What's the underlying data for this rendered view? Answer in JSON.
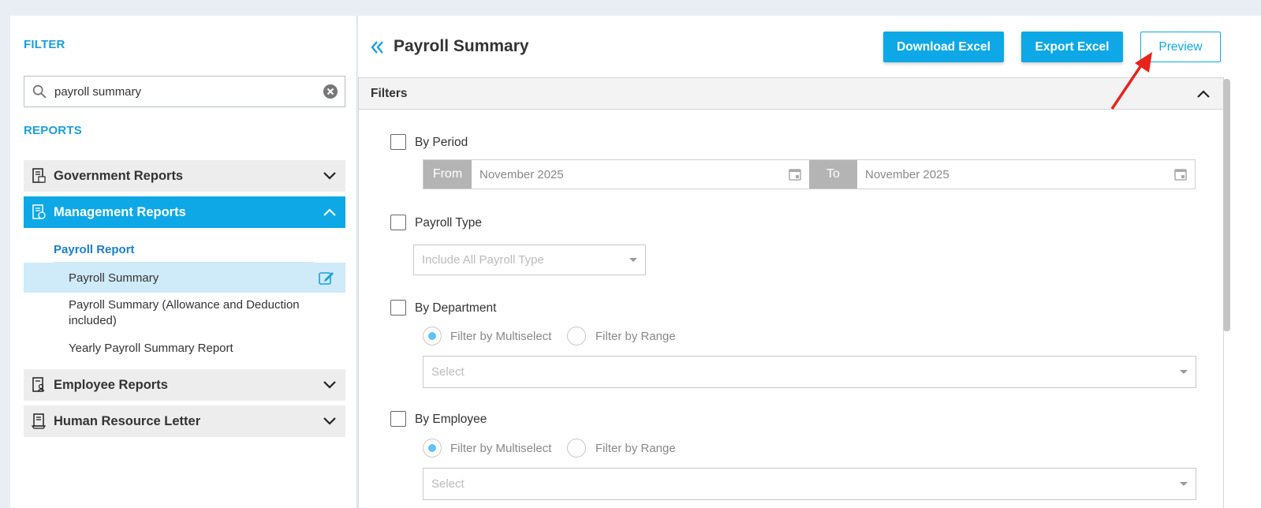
{
  "sidebar": {
    "filter_title": "FILTER",
    "search_value": "payroll summary",
    "reports_title": "REPORTS",
    "categories": [
      {
        "label": "Government Reports"
      },
      {
        "label": "Management Reports"
      },
      {
        "label": "Employee Reports"
      },
      {
        "label": "Human Resource Letter"
      }
    ],
    "sub_heading": "Payroll Report",
    "items": [
      {
        "label": "Payroll Summary"
      },
      {
        "label": "Payroll Summary (Allowance and Deduction included)"
      },
      {
        "label": "Yearly Payroll Summary Report"
      }
    ]
  },
  "main": {
    "title": "Payroll Summary",
    "download_excel": "Download Excel",
    "export_excel": "Export Excel",
    "preview": "Preview",
    "filters_title": "Filters",
    "by_period": "By Period",
    "from_label": "From",
    "from_value": "November 2025",
    "to_label": "To",
    "to_value": "November 2025",
    "payroll_type": "Payroll Type",
    "payroll_type_placeholder": "Include All Payroll Type",
    "by_department": "By Department",
    "by_employee": "By Employee",
    "filter_multiselect": "Filter by Multiselect",
    "filter_range": "Filter by Range",
    "select_placeholder": "Select"
  },
  "colors": {
    "accent": "#0ea8e6",
    "arrow": "#e8221c"
  }
}
